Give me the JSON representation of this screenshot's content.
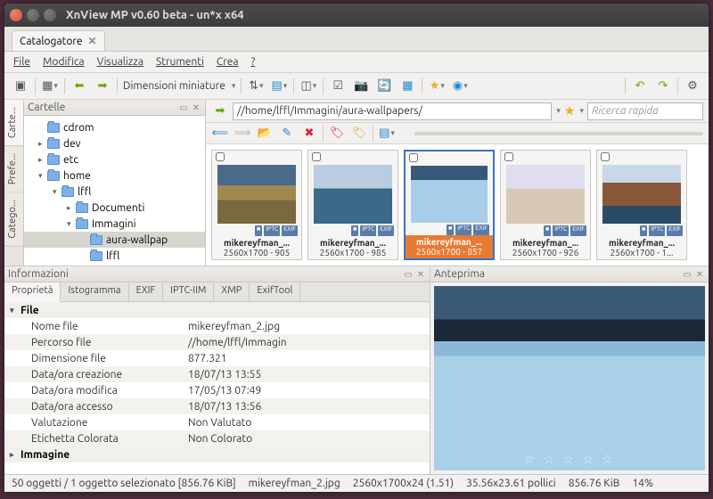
{
  "window": {
    "title": "XnView MP v0.60 beta - un*x x64"
  },
  "tabs": {
    "main": "Catalogatore"
  },
  "menu": {
    "file": "File",
    "edit": "Modifica",
    "view": "Visualizza",
    "tools": "Strumenti",
    "create": "Crea",
    "help": "?"
  },
  "toolbar": {
    "dim_label": "Dimensioni miniature"
  },
  "sidetabs": {
    "folders": "Carte...",
    "prefs": "Prefe...",
    "cats": "Catego..."
  },
  "folders_panel": {
    "title": "Cartelle"
  },
  "tree": {
    "cdrom": "cdrom",
    "dev": "dev",
    "etc": "etc",
    "home": "home",
    "lffl": "lffl",
    "documenti": "Documenti",
    "immagini": "Immagini",
    "aura": "aura-wallpap",
    "lffl2": "lffl"
  },
  "path": "//home/lffl/Immagini/aura-wallpapers/",
  "search": {
    "placeholder": "Ricerca rapida"
  },
  "thumbs": [
    {
      "name": "mikereyfman_...",
      "dim": "2560x1700 - 905"
    },
    {
      "name": "mikereyfman_...",
      "dim": "2560x1700 - 985"
    },
    {
      "name": "mikereyfman_...",
      "dim": "2560x1700 - 857"
    },
    {
      "name": "mikereyfman_...",
      "dim": "2560x1700 - 926"
    },
    {
      "name": "mikereyfman_...",
      "dim": "2560x1700 - 1..."
    }
  ],
  "badges": {
    "raw": "■",
    "iptc": "IPTC",
    "exif": "EXIF"
  },
  "info_panel": {
    "title": "Informazioni"
  },
  "infotabs": {
    "prop": "Proprietà",
    "hist": "Istogramma",
    "exif": "EXIF",
    "iptc": "IPTC-IIM",
    "xmp": "XMP",
    "et": "ExifTool"
  },
  "props": {
    "file_hdr": "File",
    "image_hdr": "Immagine",
    "rows": [
      {
        "k": "Nome file",
        "v": "mikereyfman_2.jpg"
      },
      {
        "k": "Percorso file",
        "v": "//home/lffl/Immagin"
      },
      {
        "k": "Dimensione file",
        "v": "877.321"
      },
      {
        "k": "Data/ora creazione",
        "v": "18/07/13 13:55"
      },
      {
        "k": "Data/ora modifica",
        "v": "17/05/13 07:49"
      },
      {
        "k": "Data/ora accesso",
        "v": "18/07/13 13:56"
      },
      {
        "k": "Valutazione",
        "v": "Non Valutato"
      },
      {
        "k": "Etichetta Colorata",
        "v": "Non Colorato"
      }
    ]
  },
  "preview_panel": {
    "title": "Anteprima"
  },
  "status": {
    "sel": "50 oggetti / 1 oggetto selezionato [856.76 KiB]",
    "fname": "mikereyfman_2.jpg",
    "dim": "2560x1700x24 (1.51)",
    "inches": "35.56x23.61 pollici",
    "size": "856.76 KiB",
    "zoom": "14%"
  }
}
